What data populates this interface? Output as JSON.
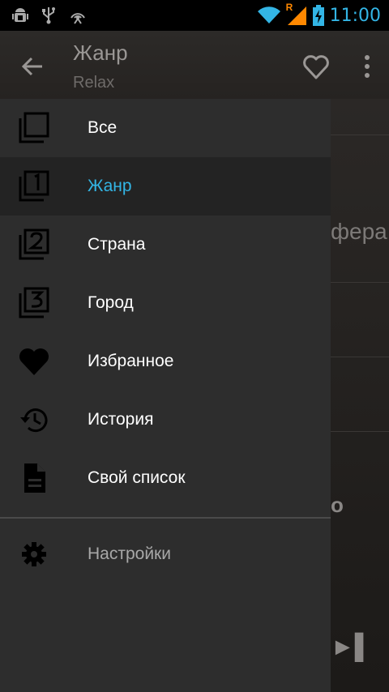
{
  "status_bar": {
    "time": "11:00",
    "roaming_indicator": "R",
    "icons": [
      "android-debug-icon",
      "usb-icon",
      "hotspot-icon",
      "wifi-icon",
      "signal-icon",
      "battery-charging-icon"
    ]
  },
  "app_bar": {
    "title": "Жанр",
    "subtitle": "Relax"
  },
  "drawer": {
    "items": [
      {
        "label": "Все",
        "icon": "all-collections-icon"
      },
      {
        "label": "Жанр",
        "icon": "collection-1-icon",
        "selected": true
      },
      {
        "label": "Страна",
        "icon": "collection-2-icon"
      },
      {
        "label": "Город",
        "icon": "collection-3-icon"
      },
      {
        "label": "Избранное",
        "icon": "heart-icon"
      },
      {
        "label": "История",
        "icon": "history-icon"
      },
      {
        "label": "Свой список",
        "icon": "document-icon"
      }
    ],
    "settings_label": "Настройки"
  },
  "background": {
    "partial_text": "фера",
    "partial_text_2": "о",
    "controls": "►▌"
  },
  "colors": {
    "accent": "#33b5e5",
    "drawer_bg": "#2d2d2d",
    "selected_bg": "#232323"
  }
}
